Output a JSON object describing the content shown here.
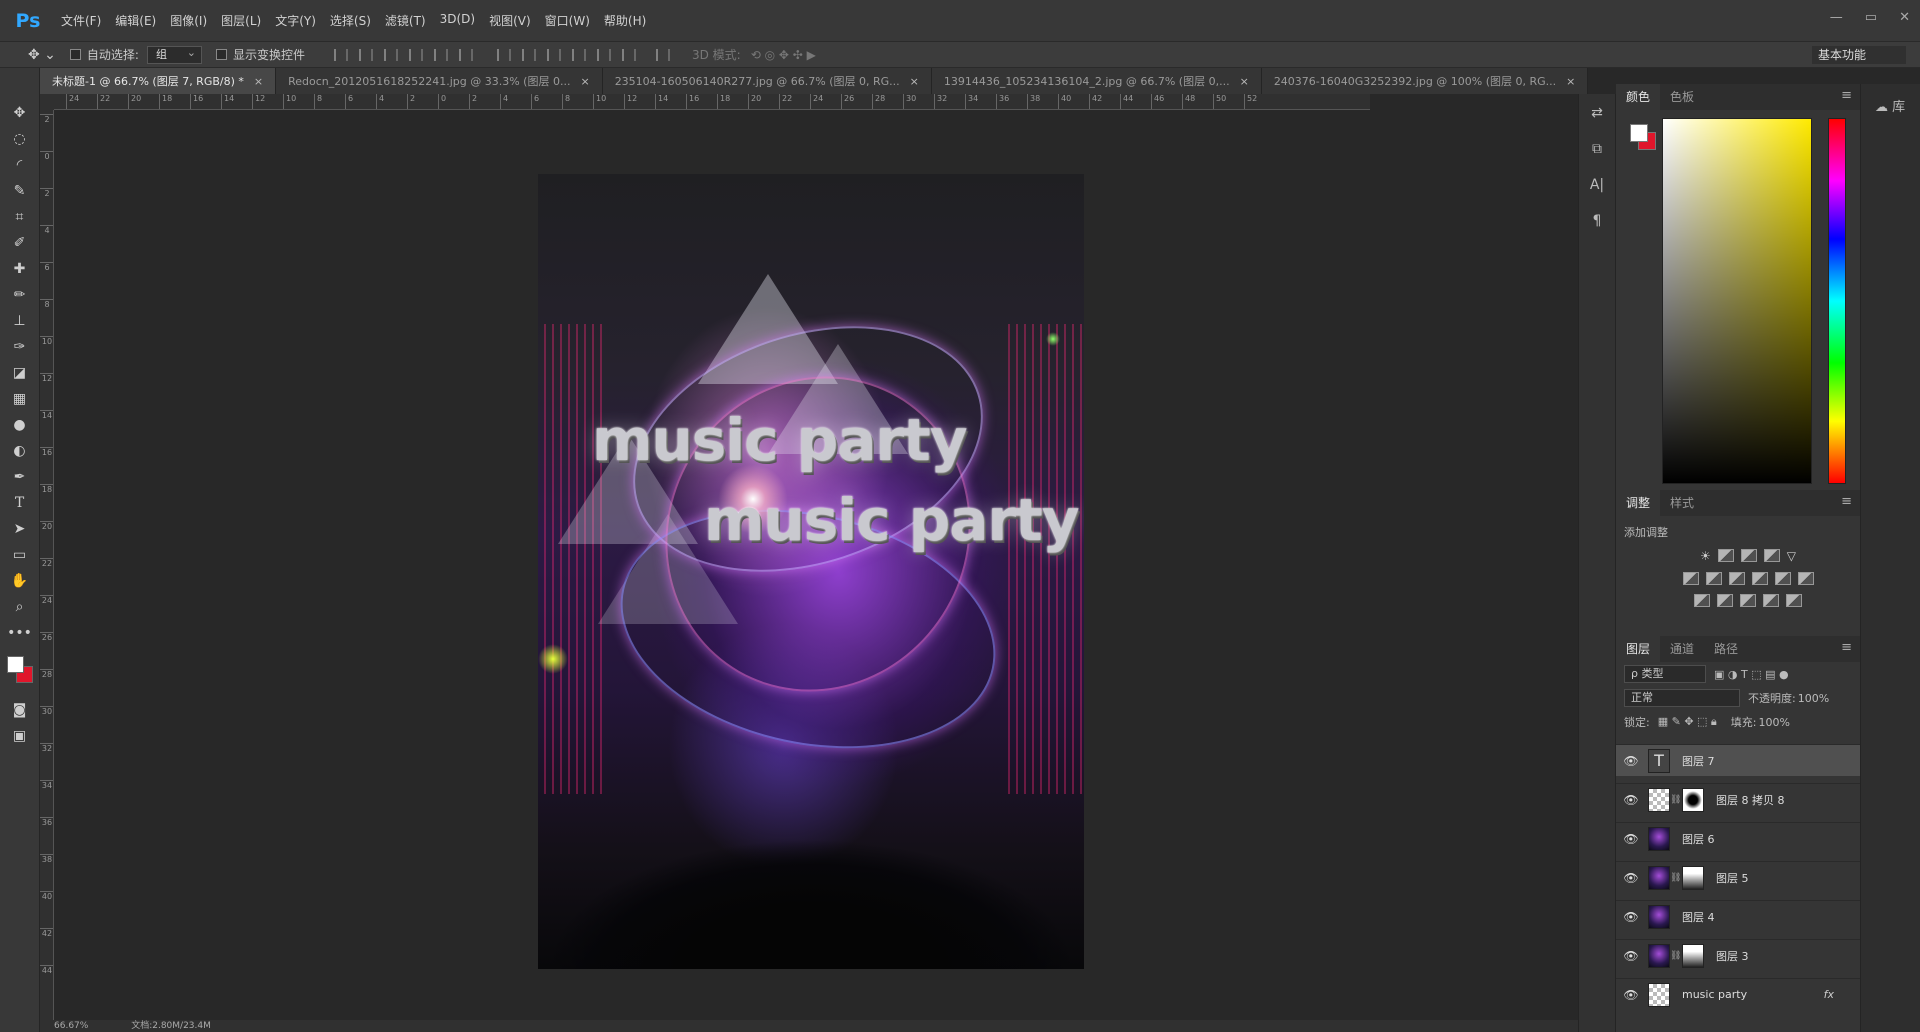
{
  "menubar": {
    "logo": "Ps",
    "items": [
      "文件(F)",
      "编辑(E)",
      "图像(I)",
      "图层(L)",
      "文字(Y)",
      "选择(S)",
      "滤镜(T)",
      "3D(D)",
      "视图(V)",
      "窗口(W)",
      "帮助(H)"
    ],
    "window_controls": [
      "—",
      "▭",
      "✕"
    ]
  },
  "options": {
    "auto_select_label": "自动选择:",
    "auto_select_value": "组",
    "show_transform_label": "显示变换控件",
    "mode_3d_label": "3D 模式:",
    "workspace": "基本功能"
  },
  "tabs": [
    {
      "label": "未标题-1 @ 66.7% (图层 7, RGB/8) *",
      "active": true
    },
    {
      "label": "Redocn_2012051618252241.jpg @ 33.3% (图层 0...",
      "active": false
    },
    {
      "label": "235104-160506140R277.jpg @ 66.7% (图层 0, RG...",
      "active": false
    },
    {
      "label": "13914436_105234136104_2.jpg @ 66.7% (图层 0,...",
      "active": false
    },
    {
      "label": "240376-16040G3252392.jpg @ 100% (图层 0, RG...",
      "active": false
    }
  ],
  "ruler_top": [
    "24",
    "22",
    "20",
    "18",
    "16",
    "14",
    "12",
    "10",
    "8",
    "6",
    "4",
    "2",
    "0",
    "2",
    "4",
    "6",
    "8",
    "10",
    "12",
    "14",
    "16",
    "18",
    "20",
    "22",
    "24",
    "26",
    "28",
    "30",
    "32",
    "34",
    "36",
    "38",
    "40",
    "42",
    "44",
    "46",
    "48",
    "50",
    "52"
  ],
  "ruler_left": [
    "2",
    "0",
    "2",
    "4",
    "6",
    "8",
    "10",
    "12",
    "14",
    "16",
    "18",
    "20",
    "22",
    "24",
    "26",
    "28",
    "30",
    "32",
    "34",
    "36",
    "38",
    "40",
    "42",
    "44"
  ],
  "artwork": {
    "headline_1": "music party",
    "headline_2": "music party"
  },
  "color_panel": {
    "tabs": [
      "颜色",
      "色板"
    ],
    "fg": "#ffffff",
    "bg": "#e0162b"
  },
  "adjust_panel": {
    "tabs": [
      "调整",
      "样式"
    ],
    "title": "添加调整"
  },
  "layers_panel": {
    "tabs": [
      "图层",
      "通道",
      "路径"
    ],
    "filter_kind": "ρ 类型",
    "blend_mode": "正常",
    "opacity_label": "不透明度:",
    "opacity_value": "100%",
    "lock_label": "锁定:",
    "fill_label": "填充:",
    "fill_value": "100%",
    "layers": [
      {
        "name": "图层 7",
        "thumb": "text",
        "mask": false,
        "selected": true
      },
      {
        "name": "图层 8 拷贝 8",
        "thumb": "checker",
        "mask": "mask",
        "selected": false
      },
      {
        "name": "图层 6",
        "thumb": "photo",
        "mask": false,
        "selected": false
      },
      {
        "name": "图层 5",
        "thumb": "photo",
        "mask": "mask2",
        "selected": false
      },
      {
        "name": "图层 4",
        "thumb": "photo",
        "mask": false,
        "selected": false
      },
      {
        "name": "图层 3",
        "thumb": "photo",
        "mask": "mask2",
        "selected": false
      },
      {
        "name": "music party",
        "thumb": "checker",
        "mask": false,
        "selected": false,
        "fx": "fx"
      }
    ]
  },
  "status": {
    "zoom": "66.67%",
    "doc": "文档:2.80M/23.4M"
  },
  "far_right_label": "库"
}
